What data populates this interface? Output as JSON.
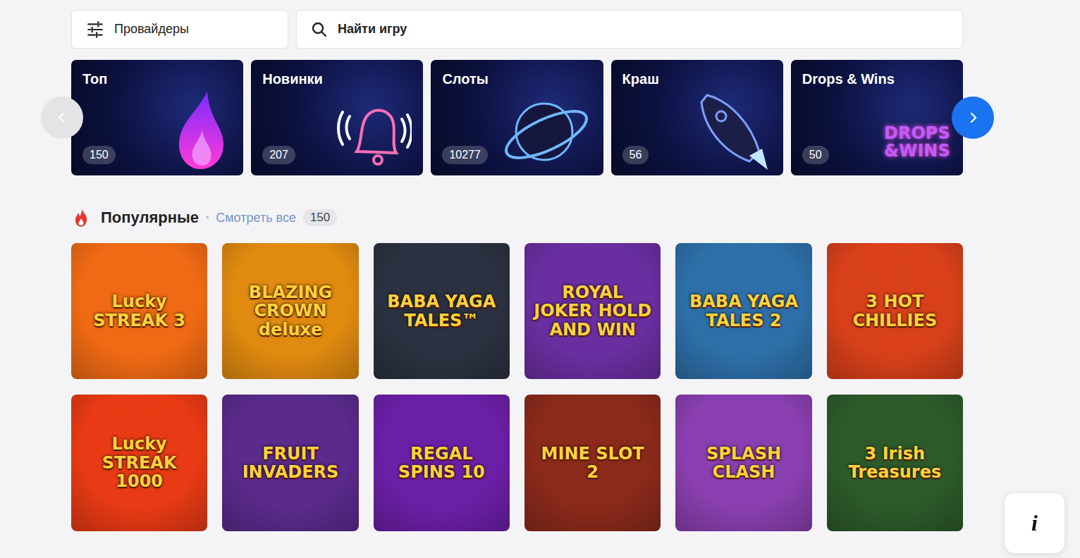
{
  "search_bar": {
    "providers_label": "Провайдеры",
    "search_placeholder": "Найти игру"
  },
  "categories": [
    {
      "label": "Топ",
      "count": "150",
      "kind": "top"
    },
    {
      "label": "Новинки",
      "count": "207",
      "kind": "new"
    },
    {
      "label": "Слоты",
      "count": "10277",
      "kind": "slots"
    },
    {
      "label": "Краш",
      "count": "56",
      "kind": "crash"
    },
    {
      "label": "Drops & Wins",
      "count": "50",
      "kind": "drops",
      "icon_text": "DROPS &WINS"
    }
  ],
  "carousel": {
    "prev_enabled": false,
    "next_enabled": true
  },
  "section": {
    "title": "Популярные",
    "separator": "•",
    "view_all": "Смотреть все",
    "count": "150"
  },
  "games": [
    {
      "title": "Lucky STREAK 3",
      "color": "#f06a14"
    },
    {
      "title": "BLAZING CROWN deluxe",
      "color": "#e08a10"
    },
    {
      "title": "BABA YAGA TALES™",
      "color": "#2b3140"
    },
    {
      "title": "ROYAL JOKER HOLD AND WIN",
      "color": "#6a2ea0"
    },
    {
      "title": "BABA YAGA TALES 2",
      "color": "#2d6fa8"
    },
    {
      "title": "3 HOT CHILLIES",
      "color": "#d8401a"
    },
    {
      "title": "Lucky STREAK 1000",
      "color": "#e83a14"
    },
    {
      "title": "FRUIT INVADERS",
      "color": "#5a2a8c"
    },
    {
      "title": "REGAL SPINS 10",
      "color": "#6b1fa6"
    },
    {
      "title": "MINE SLOT 2",
      "color": "#8a2a1a"
    },
    {
      "title": "SPLASH CLASH",
      "color": "#8a3fb0"
    },
    {
      "title": "3 Irish Treasures",
      "color": "#2d5a2a"
    }
  ],
  "info_button": {
    "label": "i"
  }
}
